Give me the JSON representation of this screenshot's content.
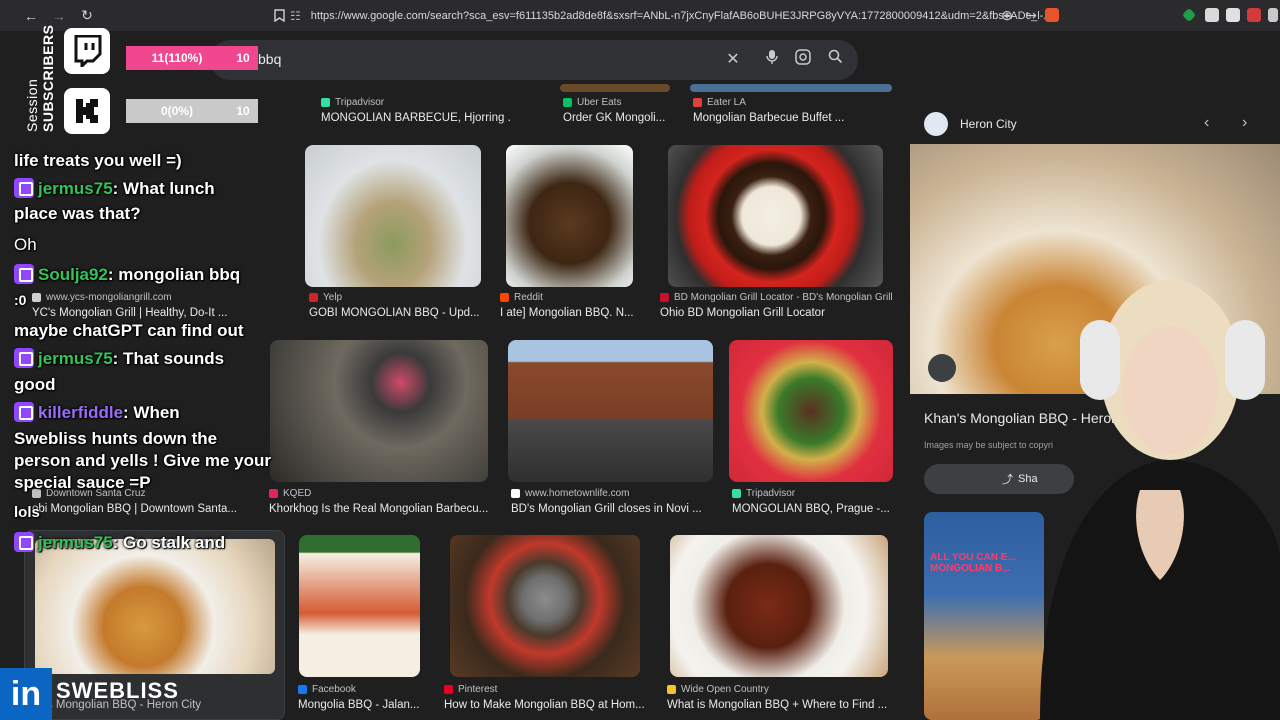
{
  "browser": {
    "url": "https://www.google.com/search?sca_esv=f611135b2ad8de8f&sxsrf=ANbL-n7jxCnyFlafAB6oBUHE3JRPG8yVYA:1772800009412&udm=2&fbs=ADc_l-..."
  },
  "search": {
    "query": "bbq"
  },
  "results": [
    {
      "source": "Tripadvisor",
      "caption": "MONGOLIAN BARBECUE, Hjorring ..."
    },
    {
      "source": "Uber Eats",
      "caption": "Order GK Mongoli..."
    },
    {
      "source": "Eater LA",
      "caption": "Mongolian Barbecue Buffet ..."
    },
    {
      "source": "Yelp",
      "caption": "GOBI MONGOLIAN BBQ - Upd..."
    },
    {
      "source": "Reddit",
      "caption": "I ate] Mongolian BBQ. N..."
    },
    {
      "source": "BD Mongolian Grill Locator - BD's Mongolian Grill",
      "caption": "Ohio BD Mongolian Grill Locator"
    },
    {
      "source": "www.ycs-mongoliangrill.com",
      "caption": "YC's Mongolian Grill | Healthy, Do-It ..."
    },
    {
      "source": "Downtown Santa Cruz",
      "caption": "obi Mongolian BBQ | Downtown Santa..."
    },
    {
      "source": "KQED",
      "caption": "Khorkhog Is the Real Mongolian Barbecu..."
    },
    {
      "source": "www.hometownlife.com",
      "caption": "BD's Mongolian Grill closes in Novi ..."
    },
    {
      "source": "Tripadvisor",
      "caption": "MONGOLIAN BBQ, Prague -..."
    },
    {
      "source": "",
      "caption": "an's Mongolian BBQ - Heron City"
    },
    {
      "source": "Facebook",
      "caption": "Mongolia BBQ - Jalan..."
    },
    {
      "source": "Pinterest",
      "caption": "How to Make Mongolian BBQ at Hom..."
    },
    {
      "source": "Wide Open Country",
      "caption": "What is Mongolian BBQ + Where to Find ..."
    }
  ],
  "panel": {
    "site": "Heron City",
    "title": "Khan's Mongolian BBQ - Heron C",
    "copyright": "Images may be subject to copyri",
    "share": "Sha",
    "thumb_text": "ALL YOU CAN E... MONGOLIAN B..."
  },
  "overlay": {
    "subs_progress": "11(110%)",
    "subs_goal": "10",
    "session_progress": "0(0%)",
    "session_goal": "10",
    "label_session": "Session",
    "label_subscribers": "SUBSCRIBERS",
    "subs_fill": 1.0,
    "session_fill": 0.0,
    "linkedin": "in",
    "handle": "SWEBLISS"
  },
  "chat": [
    {
      "text": "life treats you well =)"
    },
    {
      "user": "jermus75",
      "text": ": What lunch"
    },
    {
      "text": "place was that?"
    },
    {
      "text": "Oh"
    },
    {
      "user": "Soulja92",
      "text": ": mongolian bbq"
    },
    {
      "text": ":0"
    },
    {
      "text": "maybe chatGPT can find out"
    },
    {
      "user": "jermus75",
      "text": ": That sounds"
    },
    {
      "text": "good"
    },
    {
      "user": "killerfiddle",
      "text": ": When"
    },
    {
      "text": "Swebliss hunts down the"
    },
    {
      "text": "person and yells ! Give me your"
    },
    {
      "text": "special sauce =P"
    },
    {
      "text": "lols"
    },
    {
      "user": "jermus75",
      "text": ": Go stalk and"
    }
  ],
  "colors": {
    "bg": "#1f1f1f",
    "twitch": "#9146ff",
    "subs_bar": "#f0478f",
    "linkedin": "#0a66c2",
    "chat_user": "#33c35a"
  }
}
